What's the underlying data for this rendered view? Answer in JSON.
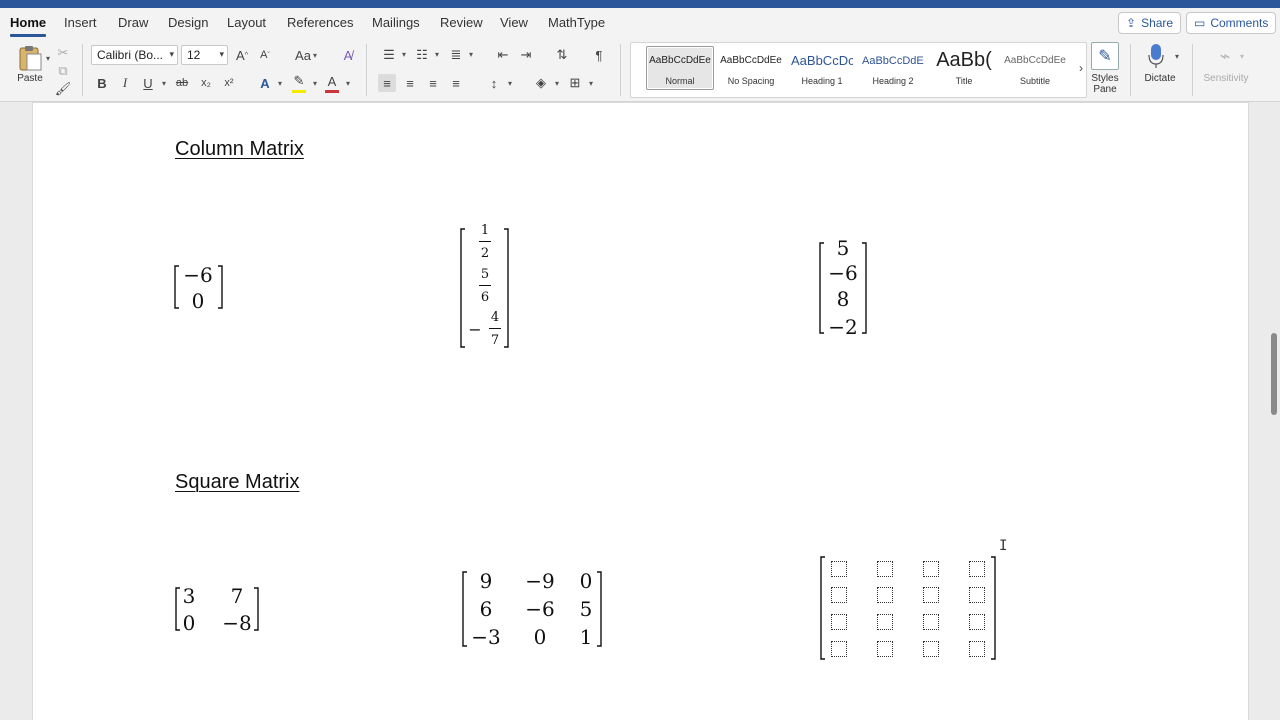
{
  "tabs": [
    "Home",
    "Insert",
    "Draw",
    "Design",
    "Layout",
    "References",
    "Mailings",
    "Review",
    "View",
    "MathType"
  ],
  "top_right": {
    "share": "Share",
    "comments": "Comments"
  },
  "ribbon": {
    "paste_label": "Paste",
    "font_name": "Calibri (Bo...",
    "font_size": "12",
    "grow_font": "A^",
    "shrink_font": "A˅",
    "case": "Aa",
    "bold": "B",
    "italic": "I",
    "underline": "U",
    "strike": "ab",
    "subscript": "x₂",
    "superscript": "x²",
    "pilcrow": "¶",
    "styles": [
      {
        "sample": "AaBbCcDdEe",
        "name": "Normal"
      },
      {
        "sample": "AaBbCcDdEe",
        "name": "No Spacing"
      },
      {
        "sample": "AaBbCcDc",
        "name": "Heading 1"
      },
      {
        "sample": "AaBbCcDdEe",
        "name": "Heading 2"
      },
      {
        "sample": "AaBb(",
        "name": "Title"
      },
      {
        "sample": "AaBbCcDdEe",
        "name": "Subtitle"
      }
    ],
    "styles_pane": "Styles Pane",
    "dictate": "Dictate",
    "sensitivity": "Sensitivity",
    "accent_color": "#2b579a",
    "highlight_color": "#f5e900",
    "font_color": "#d13438"
  },
  "document": {
    "heading_column": "Column Matrix",
    "heading_square": "Square Matrix",
    "col_matrix_1": [
      "−6",
      "0"
    ],
    "col_matrix_2": [
      {
        "num": "1",
        "den": "2",
        "sign": ""
      },
      {
        "num": "5",
        "den": "6",
        "sign": ""
      },
      {
        "num": "4",
        "den": "7",
        "sign": "−"
      }
    ],
    "col_matrix_3": [
      "5",
      "−6",
      "8",
      "−2"
    ],
    "sq_matrix_1": [
      [
        "3",
        "7"
      ],
      [
        "0",
        "−8"
      ]
    ],
    "sq_matrix_2": [
      [
        "9",
        "−9",
        "0"
      ],
      [
        "6",
        "−6",
        "5"
      ],
      [
        "−3",
        "0",
        "1"
      ]
    ],
    "sq_matrix_3_size": "4x4 empty placeholders"
  }
}
